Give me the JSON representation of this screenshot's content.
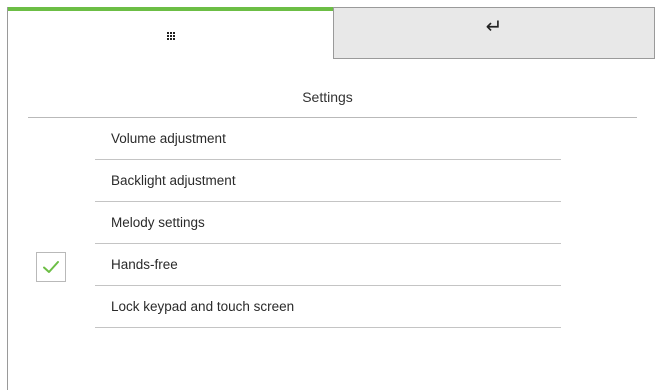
{
  "colors": {
    "accent": "#6cbe45",
    "tab_inactive_bg": "#e8e8e8",
    "divider": "#c4c4c4",
    "check": "#6cbe45"
  },
  "tabs": {
    "home_icon": "grid-menu-icon",
    "back_icon": "return-arrow-icon",
    "back_glyph": "↵"
  },
  "page": {
    "title": "Settings"
  },
  "menu": {
    "items": [
      {
        "label": "Volume adjustment",
        "checked": false
      },
      {
        "label": "Backlight adjustment",
        "checked": false
      },
      {
        "label": "Melody settings",
        "checked": false
      },
      {
        "label": "Hands-free",
        "checked": true
      },
      {
        "label": "Lock keypad and touch screen",
        "checked": false
      }
    ]
  },
  "hands_free_checkbox": {
    "icon": "checkmark-icon",
    "checked": true
  }
}
